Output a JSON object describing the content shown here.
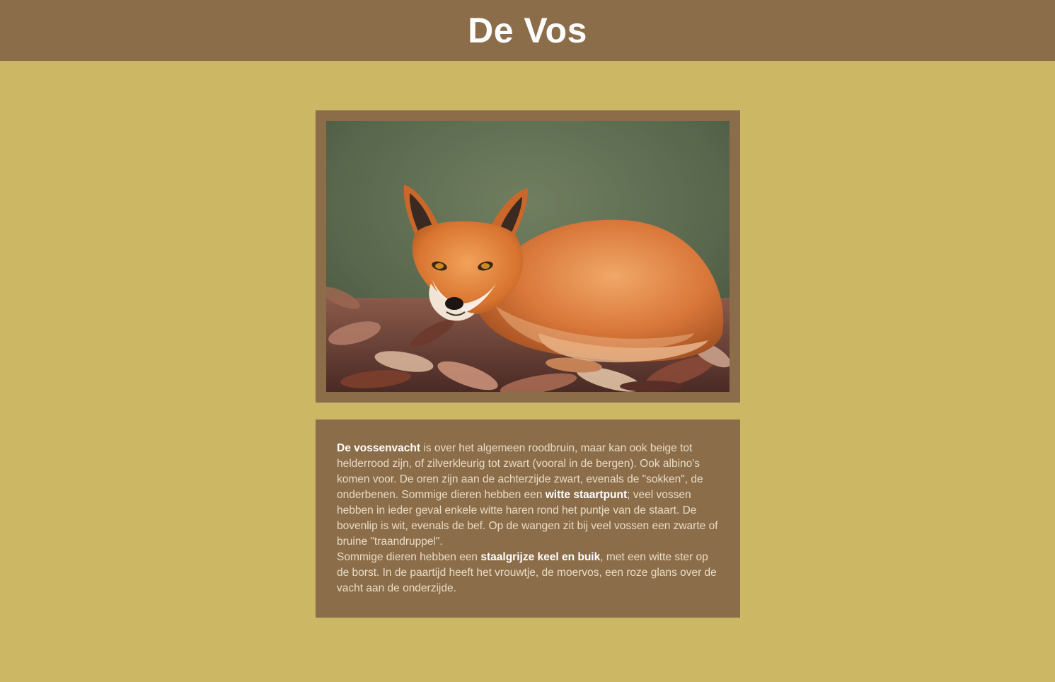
{
  "page": {
    "title": "De Vos"
  },
  "photo": {
    "alt": "fox-photo",
    "subject": "red fox lying curled up on autumn leaves"
  },
  "description": {
    "p1": {
      "bold1": "De vossenvacht",
      "text1": " is over het algemeen roodbruin, maar kan ook beige tot helderrood zijn, of zilverkleurig tot zwart (vooral in de bergen). Ook albino's komen voor. De oren zijn aan de achterzijde zwart, evenals de \"sokken\", de onderbenen. Sommige dieren hebben een ",
      "bold2": "witte staartpunt",
      "text2": "; veel vossen hebben in ieder geval enkele witte haren rond het puntje van de staart. De bovenlip is wit, evenals de bef. Op de wangen zit bij veel vossen een zwarte of bruine \"traandruppel\"."
    },
    "p2": {
      "text1": "Sommige dieren hebben een ",
      "bold1": "staalgrijze keel en buik",
      "text2": ", met een witte ster op de borst. In de paartijd heeft het vrouwtje, de moervos, een roze glans over de vacht aan de onderzijde."
    }
  },
  "colors": {
    "background": "#cbb764",
    "header": "#8c6d4a",
    "card": "#8c6d4a",
    "title_text": "#ffffff",
    "body_text": "#e8dcc4"
  }
}
